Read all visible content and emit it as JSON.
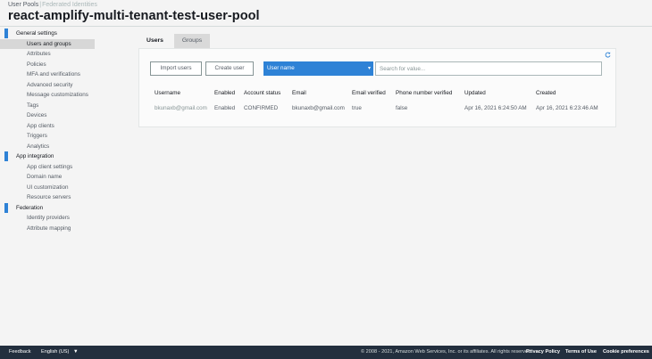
{
  "header": {
    "tab_user_pools": "User Pools",
    "separator": "|",
    "tab_federated": "Federated Identities",
    "pool_name": "react-amplify-multi-tenant-test-user-pool"
  },
  "sidebar": {
    "general_settings": "General settings",
    "general_items": [
      "Users and groups",
      "Attributes",
      "Policies",
      "MFA and verifications",
      "Advanced security",
      "Message customizations",
      "Tags",
      "Devices",
      "App clients",
      "Triggers",
      "Analytics"
    ],
    "app_integration": "App integration",
    "app_items": [
      "App client settings",
      "Domain name",
      "UI customization",
      "Resource servers"
    ],
    "federation": "Federation",
    "federation_items": [
      "Identity providers",
      "Attribute mapping"
    ]
  },
  "tabs": {
    "users": "Users",
    "groups": "Groups"
  },
  "toolbar": {
    "import_label": "Import users",
    "create_label": "Create user",
    "filter_selected": "User name",
    "search_placeholder": "Search for value..."
  },
  "table": {
    "headers": [
      "Username",
      "Enabled",
      "Account status",
      "Email",
      "Email verified",
      "Phone number verified",
      "Updated",
      "Created"
    ],
    "rows": [
      {
        "username": "bkunaxb@gmail.com",
        "enabled": "Enabled",
        "status": "CONFIRMED",
        "email": "bkunaxb@gmail.com",
        "email_verified": "true",
        "phone_verified": "false",
        "updated": "Apr 16, 2021 6:24:50 AM",
        "created": "Apr 16, 2021 6:23:46 AM"
      }
    ]
  },
  "footer": {
    "feedback": "Feedback",
    "language": "English (US)",
    "copyright": "© 2008 - 2021, Amazon Web Services, Inc. or its affiliates. All rights reserved.",
    "privacy": "Privacy Policy",
    "terms": "Terms of Use",
    "cookies": "Cookie preferences"
  },
  "colors": {
    "accent": "#2e82d6",
    "footer_bg": "#232f3e"
  }
}
